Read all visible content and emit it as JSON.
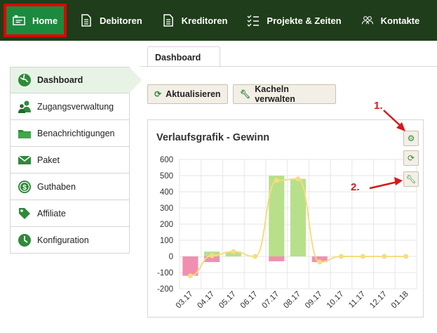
{
  "nav": {
    "items": [
      {
        "label": "Home",
        "icon": "home-icon"
      },
      {
        "label": "Debitoren",
        "icon": "document-icon"
      },
      {
        "label": "Kreditoren",
        "icon": "document-icon"
      },
      {
        "label": "Projekte & Zeiten",
        "icon": "checklist-icon"
      },
      {
        "label": "Kontakte",
        "icon": "people-icon"
      }
    ]
  },
  "tabs": [
    {
      "label": "Dashboard"
    }
  ],
  "sidebar": {
    "items": [
      {
        "label": "Dashboard",
        "icon": "globe-icon"
      },
      {
        "label": "Zugangsverwaltung",
        "icon": "users-icon"
      },
      {
        "label": "Benachrichtigungen",
        "icon": "folder-icon"
      },
      {
        "label": "Paket",
        "icon": "envelope-icon"
      },
      {
        "label": "Guthaben",
        "icon": "dollar-icon"
      },
      {
        "label": "Affiliate",
        "icon": "tag-icon"
      },
      {
        "label": "Konfiguration",
        "icon": "clock-icon"
      }
    ]
  },
  "toolbar": {
    "refresh_label": "Aktualisieren",
    "tiles_label": "Kacheln verwalten"
  },
  "panel": {
    "title": "Verlaufsgrafik - Gewinn"
  },
  "annotations": {
    "one": "1.",
    "two": "2."
  },
  "colors": {
    "nav_bg": "#1f3d1a",
    "home_bg": "#1c8a3e",
    "highlight": "#e00000",
    "bar_pos": "#b8e08a",
    "bar_neg": "#f28fb0",
    "line": "#f7dc80"
  },
  "chart_data": {
    "type": "bar",
    "categories": [
      "03.17",
      "04.17",
      "05.17",
      "06.17",
      "07.17",
      "08.17",
      "09.17",
      "10.17",
      "11.17",
      "12.17",
      "01.18"
    ],
    "series": [
      {
        "values": [
          0,
          30,
          30,
          0,
          500,
          480,
          0,
          0,
          0,
          0,
          0
        ],
        "color": "#b8e08a"
      },
      {
        "values": [
          -120,
          -35,
          0,
          0,
          -30,
          0,
          -35,
          0,
          0,
          0,
          0
        ],
        "color": "#f28fb0"
      },
      {
        "type": "line",
        "values": [
          -120,
          5,
          30,
          0,
          470,
          480,
          -35,
          0,
          0,
          0,
          0
        ],
        "color": "#f7dc80"
      }
    ],
    "yticks": [
      "600",
      "500",
      "400",
      "300",
      "200",
      "100",
      "0",
      "-100",
      "-200"
    ],
    "ylim": [
      -200,
      600
    ],
    "grid": true
  }
}
